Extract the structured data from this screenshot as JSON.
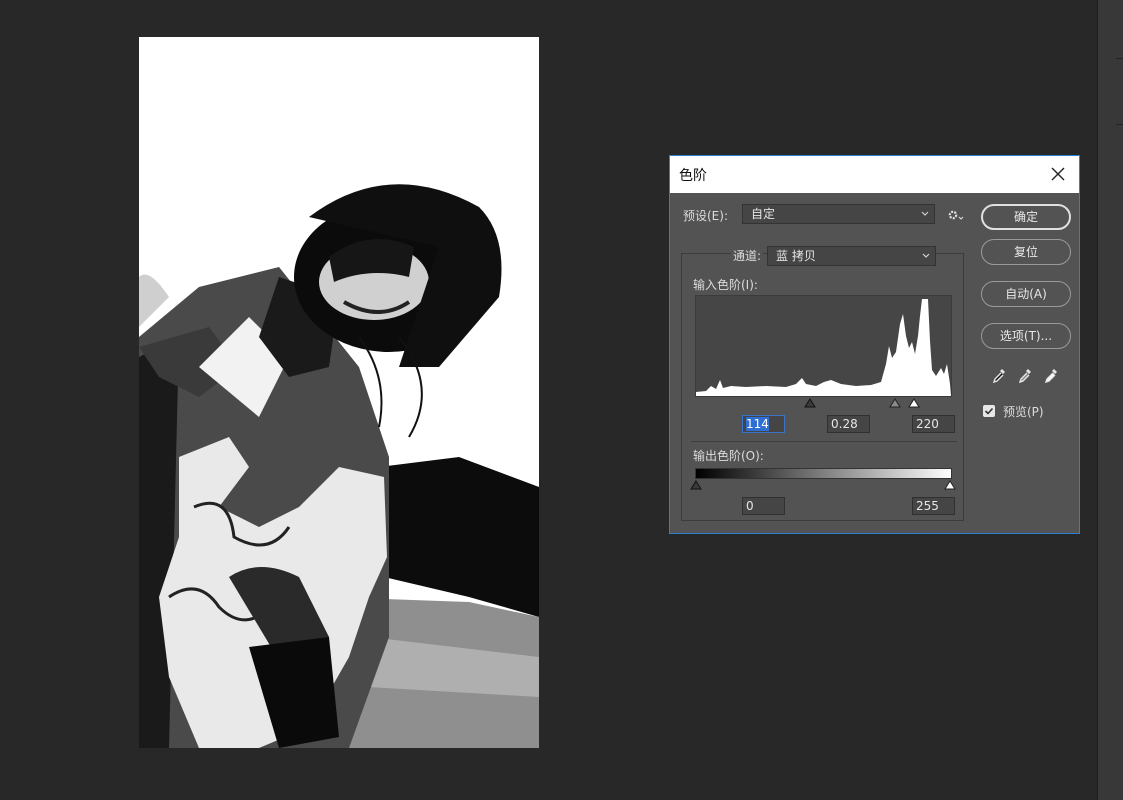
{
  "dialog": {
    "title": "色阶",
    "preset_label": "预设(E):",
    "preset_value": "自定",
    "channel_label": "通道:",
    "channel_value": "蓝 拷贝",
    "input_levels_label": "输入色阶(I):",
    "input_black": "114",
    "input_gamma": "0.28",
    "input_white": "220",
    "output_levels_label": "输出色阶(O):",
    "output_black": "0",
    "output_white": "255",
    "buttons": {
      "ok": "确定",
      "reset": "复位",
      "auto": "自动(A)",
      "options": "选项(T)..."
    },
    "preview_label": "预览(P)",
    "preview_checked": true
  },
  "colors": {
    "accent": "#2f7fd0",
    "selection": "#2f6fd1",
    "dialog_bg": "#535353",
    "workspace_bg": "#282828"
  },
  "icons": [
    "close-icon",
    "gear-icon",
    "chevron-down-icon",
    "black-eyedropper-icon",
    "gray-eyedropper-icon",
    "white-eyedropper-icon",
    "check-icon"
  ]
}
